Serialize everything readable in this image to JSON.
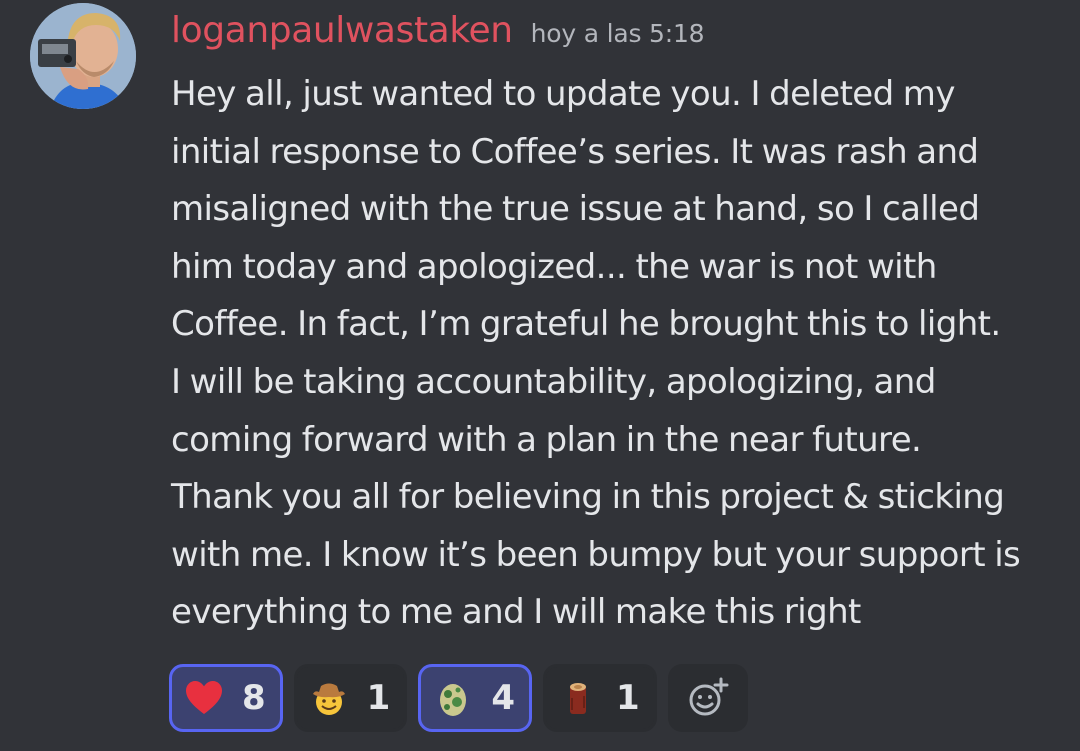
{
  "message": {
    "author": "loganpaulwastaken",
    "timestamp": "hoy a las 5:18",
    "lines": [
      "Hey all, just wanted to update you. I deleted my",
      "initial response to Coffee’s series. It was rash and",
      "misaligned with the true issue at hand, so I called",
      "him today and apologized... the war is not with",
      "Coffee. In fact, I’m grateful he brought this to light.",
      "I will be taking accountability, apologizing, and",
      "coming forward with a plan in the near future.",
      "Thank you all for believing in this project & sticking",
      "with me. I know it’s been bumpy but your support is",
      "everything to me and I will make this right"
    ]
  },
  "reactions": [
    {
      "icon": "red-heart-icon",
      "count": "8",
      "selected": true
    },
    {
      "icon": "cowboy-emoji-icon",
      "count": "1",
      "selected": false
    },
    {
      "icon": "green-egg-icon",
      "count": "4",
      "selected": true
    },
    {
      "icon": "wood-log-icon",
      "count": "1",
      "selected": false
    }
  ],
  "add_reaction": {
    "icon": "add-reaction-icon"
  },
  "colors": {
    "background": "#313338",
    "username": "#e0525f",
    "timestamp": "#b3b6bc",
    "text": "#e4e6e9",
    "reaction_bg": "#2b2d31",
    "reaction_selected_bg": "#3c4270",
    "reaction_selected_border": "#5865f2"
  }
}
